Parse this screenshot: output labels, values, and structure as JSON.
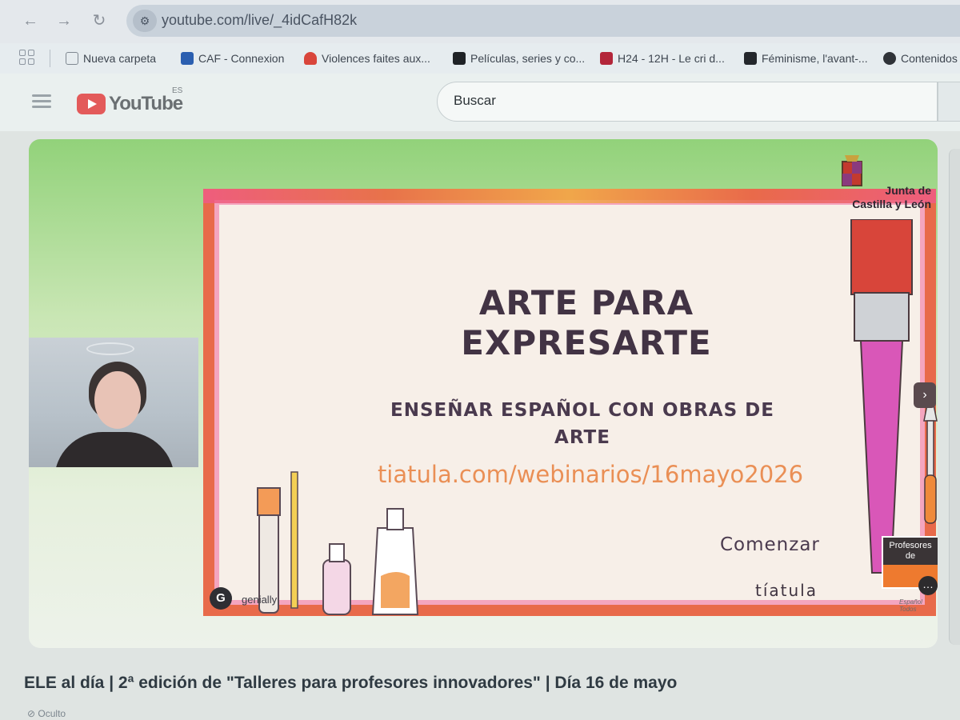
{
  "browser": {
    "url": "youtube.com/live/_4idCafH82k",
    "bookmarks": [
      {
        "label": "Nueva carpeta",
        "icon": "folder-icon"
      },
      {
        "label": "CAF - Connexion",
        "icon": "caf-icon"
      },
      {
        "label": "Violences faites aux...",
        "icon": "favicon-red"
      },
      {
        "label": "Películas, series y co...",
        "icon": "favicon-dark"
      },
      {
        "label": "H24 - 12H - Le cri d...",
        "icon": "favicon-a"
      },
      {
        "label": "Féminisme, l'avant-...",
        "icon": "favicon-book"
      },
      {
        "label": "Contenidos",
        "icon": "globe-icon"
      }
    ]
  },
  "youtube": {
    "logo_text": "YouTube",
    "region": "ES",
    "search_placeholder": "Buscar"
  },
  "slide": {
    "title_line1": "ARTE PARA",
    "title_line2": "EXPRESARTE",
    "subtitle_line1": "ENSEÑAR ESPAÑOL CON OBRAS DE",
    "subtitle_line2": "ARTE",
    "link": "tiatula.com/webinarios/16mayo2026",
    "start_button": "Comenzar",
    "brand": "tíatula",
    "badge": "Profesores de",
    "badge_footer": "Español Todos",
    "institution_line1": "Junta de",
    "institution_line2": "Castilla y León",
    "powered_by": "genially"
  },
  "video": {
    "title": "ELE al día | 2ª edición de \"Talleres para profesores innovadores\" | Día 16 de mayo",
    "visibility": "Oculto"
  },
  "colors": {
    "frame": "#e86a4a",
    "title_text": "#423344",
    "link_text": "#ea8f55",
    "youtube_red": "#e35a5a"
  }
}
